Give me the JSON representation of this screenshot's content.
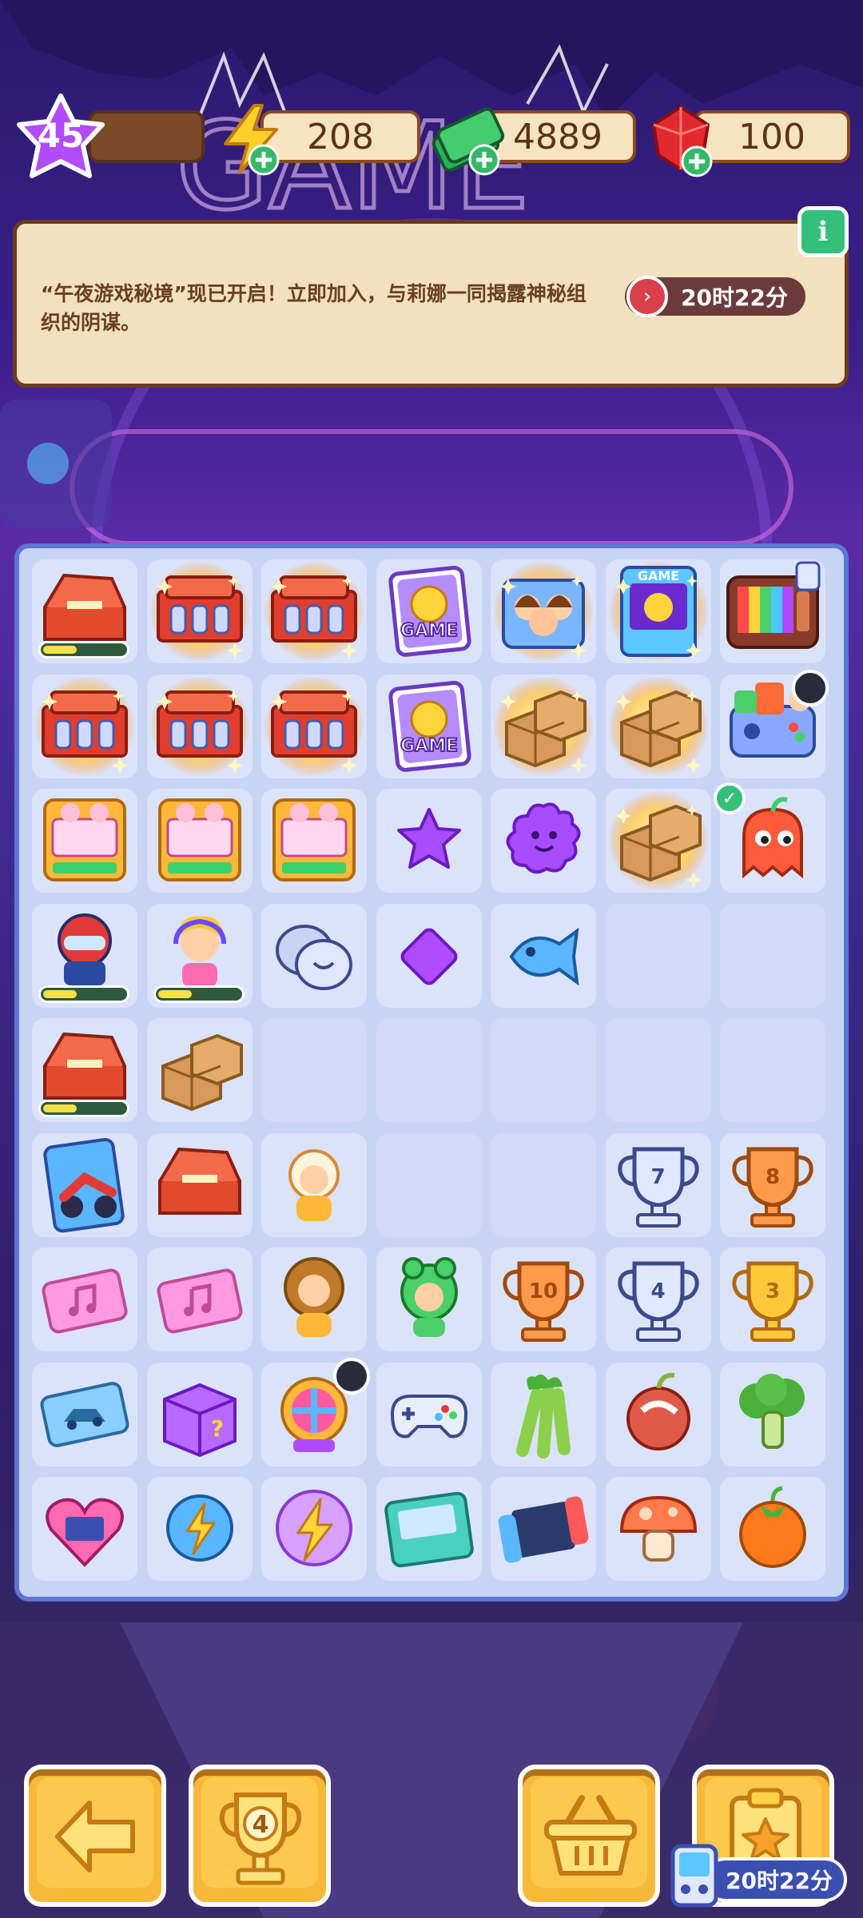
{
  "topbar": {
    "level": "45",
    "energy": "208",
    "cash": "4889",
    "gems": "100"
  },
  "event": {
    "text": "“午夜游戏秘境”现已开启！立即加入，与莉娜一同揭露神秘组织的阴谋。",
    "timer": "20时22分",
    "info_icon": "i"
  },
  "board": {
    "trophy_labels": [
      "7",
      "8",
      "10",
      "4",
      "3"
    ]
  },
  "bottom": {
    "trophy_level": "4",
    "timer": "20时22分"
  },
  "colors": {
    "board_bg": "#c8d4f4",
    "board_border": "#5e74d4",
    "button_yellow": "#f8b93a",
    "panel_bg": "#f2e0bf"
  }
}
